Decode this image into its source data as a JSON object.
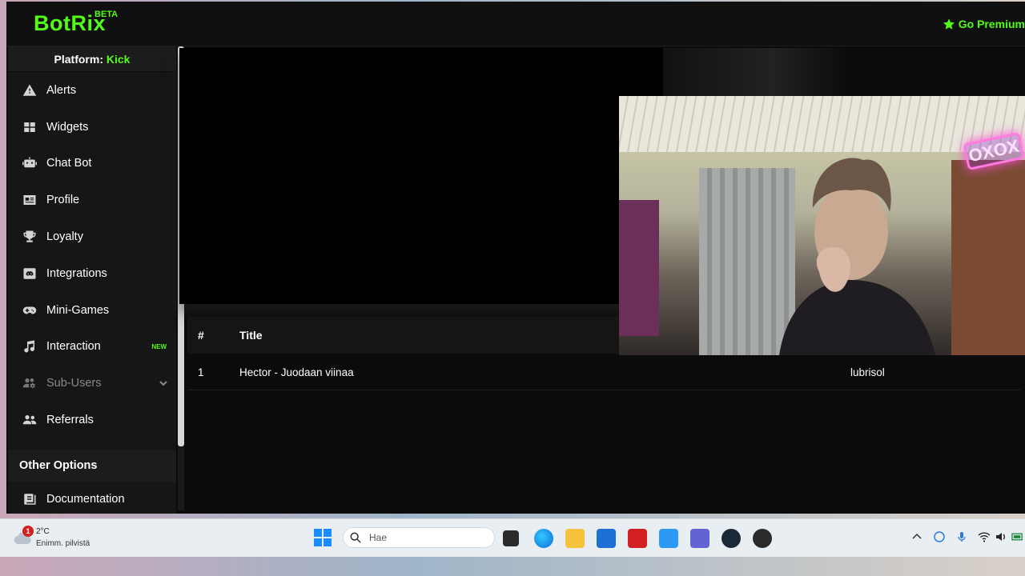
{
  "header": {
    "logo": "BotRix",
    "logo_badge": "BETA",
    "premium_label": "Go Premium"
  },
  "sidebar": {
    "platform_label": "Platform:",
    "platform_value": "Kick",
    "items": [
      {
        "label": "Alerts",
        "icon": "warning-icon"
      },
      {
        "label": "Widgets",
        "icon": "widgets-icon"
      },
      {
        "label": "Chat Bot",
        "icon": "robot-icon"
      },
      {
        "label": "Profile",
        "icon": "id-card-icon"
      },
      {
        "label": "Loyalty",
        "icon": "trophy-icon"
      },
      {
        "label": "Integrations",
        "icon": "discord-icon"
      },
      {
        "label": "Mini-Games",
        "icon": "gamepad-icon"
      },
      {
        "label": "Interaction",
        "icon": "music-icon",
        "badge": "NEW"
      },
      {
        "label": "Sub-Users",
        "icon": "users-cog-icon"
      },
      {
        "label": "Referrals",
        "icon": "users-icon"
      }
    ],
    "other_heading": "Other Options",
    "documentation_label": "Documentation"
  },
  "table": {
    "headers": [
      "#",
      "Title"
    ],
    "rows": [
      {
        "num": "1",
        "title": "Hector - Juodaan viinaa",
        "user": "lubrisol"
      }
    ]
  },
  "webcam": {
    "neon_text": "OXOX"
  },
  "taskbar": {
    "notification_count": "1",
    "temperature": "2°C",
    "weather_condition": "Enimm. pilvistä",
    "search_placeholder": "Hae"
  },
  "colors": {
    "accent": "#53fc18",
    "background": "#0b0b0b",
    "sidebar": "#161616"
  }
}
